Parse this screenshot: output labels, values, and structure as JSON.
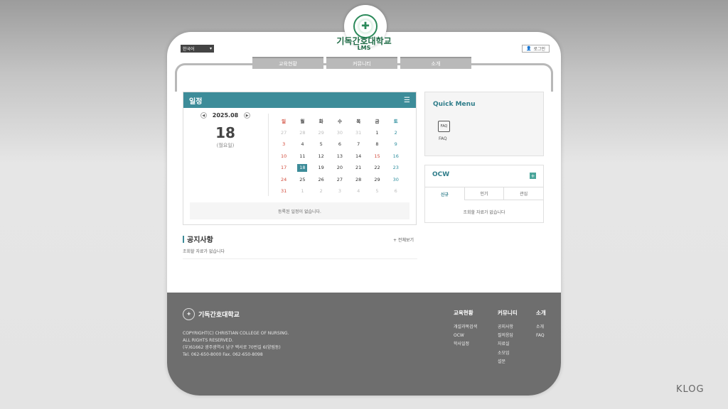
{
  "header": {
    "brand_name": "기독간호대학교",
    "brand_sub": "LMS",
    "language": "한국어",
    "login": "로그인"
  },
  "nav": {
    "tabs": [
      "교육현황",
      "커뮤니티",
      "소개"
    ]
  },
  "schedule": {
    "title": "일정",
    "month": "2025.08",
    "day": "18",
    "weekday": "(월요일)",
    "weekdays": [
      "일",
      "월",
      "화",
      "수",
      "목",
      "금",
      "토"
    ],
    "weeks": [
      [
        "27",
        "28",
        "29",
        "30",
        "31",
        "1",
        "2"
      ],
      [
        "3",
        "4",
        "5",
        "6",
        "7",
        "8",
        "9"
      ],
      [
        "10",
        "11",
        "12",
        "13",
        "14",
        "15",
        "16"
      ],
      [
        "17",
        "18",
        "19",
        "20",
        "21",
        "22",
        "23"
      ],
      [
        "24",
        "25",
        "26",
        "27",
        "28",
        "29",
        "30"
      ],
      [
        "31",
        "1",
        "2",
        "3",
        "4",
        "5",
        "6"
      ]
    ],
    "no_events": "등록된 일정이 없습니다."
  },
  "notice": {
    "title": "공지사항",
    "more": "+ 전체보기",
    "empty": "조회할 자료가 없습니다"
  },
  "quick_menu": {
    "title": "Quick Menu",
    "faq_icon": "FAQ",
    "faq_label": "FAQ"
  },
  "ocw": {
    "title": "OCW",
    "plus": "+",
    "tabs": [
      "신규",
      "인기",
      "관심"
    ],
    "empty": "조회할 자료가 없습니다"
  },
  "footer": {
    "name": "기독간호대학교",
    "copyright": "COPYRIGHT(C) CHRISTIAN COLLEGE OF NURSING.",
    "rights": "ALL RIGHTS RESERVED.",
    "address": "(우)61662 광주광역시 남구 백서로 70번길 6(양림동)",
    "tel": "Tel. 062-650-8000 Fax. 062-650-8098",
    "columns": [
      {
        "heading": "교육현황",
        "items": [
          "개설과목검색",
          "OCW",
          "학사일정"
        ]
      },
      {
        "heading": "커뮤니티",
        "items": [
          "공지사항",
          "질의응답",
          "자료실",
          "소모임",
          "설문"
        ]
      },
      {
        "heading": "소개",
        "items": [
          "소개",
          "FAQ"
        ]
      }
    ]
  },
  "watermark": "KLOG",
  "colors": {
    "accent": "#3d8c99",
    "footer": "#6e6e6e",
    "brand_green": "#1f6b46"
  }
}
